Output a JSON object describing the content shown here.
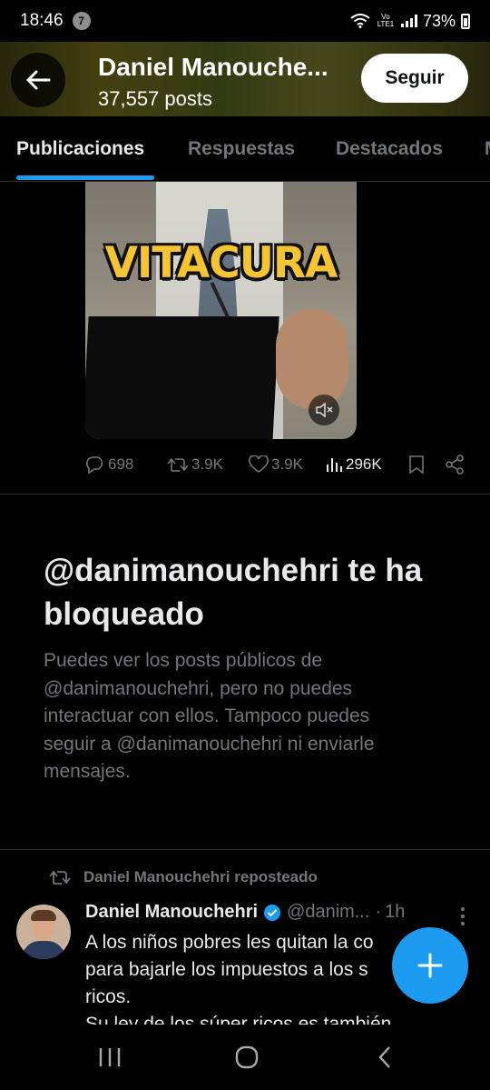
{
  "status_bar": {
    "time": "18:46",
    "notification_count": "7",
    "network_label": "Vo LTE1",
    "battery": "73%"
  },
  "header": {
    "name": "Daniel Manouche...",
    "posts": "37,557 posts",
    "follow_label": "Seguir"
  },
  "tabs": [
    {
      "label": "Publicaciones",
      "active": true
    },
    {
      "label": "Respuestas",
      "active": false
    },
    {
      "label": "Destacados",
      "active": false
    },
    {
      "label": "M",
      "active": false
    }
  ],
  "video": {
    "caption": "VITACURA"
  },
  "actions": {
    "replies": "698",
    "reposts": "3.9K",
    "likes": "3.9K",
    "views": "296K"
  },
  "blocked": {
    "title": "@danimanouchehri te ha bloqueado",
    "body": "Puedes ver los posts públicos de @danimanouchehri, pero no puedes interactuar con ellos. Tampoco puedes seguir a @danimanouchehri ni enviarle mensajes."
  },
  "tweet": {
    "repost_label": "Daniel Manouchehri reposteado",
    "name": "Daniel Manouchehri",
    "handle": "@danim...",
    "dot": "·",
    "time": "1h",
    "text": "A los niños pobres les quitan la co\npara bajarle los impuestos a los s\nricos.\nSu ley de los súper ricos es también"
  },
  "colors": {
    "accent": "#1d9bf0",
    "muted_text": "#71767b",
    "divider": "#2f3336"
  },
  "icons": {
    "back": "arrow-left-icon",
    "mute": "speaker-muted-icon",
    "reply": "comment-icon",
    "repost": "repost-icon",
    "like": "heart-icon",
    "views": "bar-chart-icon",
    "bookmark": "bookmark-icon",
    "share": "share-icon",
    "verified": "verified-badge-icon",
    "compose": "plus-icon"
  }
}
